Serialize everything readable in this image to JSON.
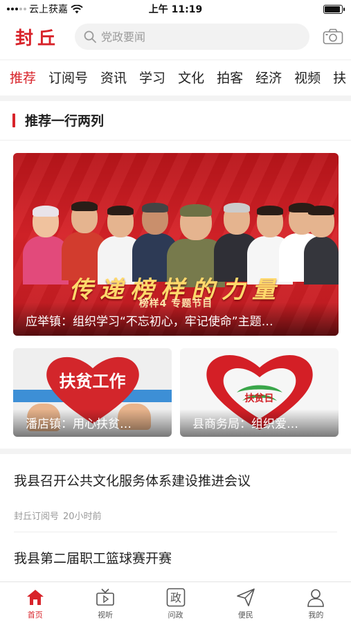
{
  "status_bar": {
    "carrier": "云上获嘉",
    "time": "上午 11:19"
  },
  "header": {
    "logo": "封丘",
    "search_placeholder": "党政要闻"
  },
  "tabs": [
    "推荐",
    "订阅号",
    "资讯",
    "学习",
    "文化",
    "拍客",
    "经济",
    "视频",
    "扶"
  ],
  "active_tab": "推荐",
  "section": {
    "title": "推荐一行两列"
  },
  "main_card": {
    "banner_title": "传递榜样的力量",
    "banner_subtitle": "榜样4 专题节目",
    "caption": "应举镇：组织学习“不忘初心，牢记使命”主题…"
  },
  "small_cards": [
    {
      "image_label": "扶贫工作",
      "caption": "潘店镇：用心扶贫…"
    },
    {
      "image_label": "扶贫日",
      "caption": "县商务局：组织爱…"
    }
  ],
  "news": [
    {
      "title": "我县召开公共文化服务体系建设推进会议",
      "source": "封丘订阅号",
      "time": "20小时前"
    },
    {
      "title": "我县第二届职工篮球赛开赛"
    }
  ],
  "bottom_nav": [
    {
      "label": "首页",
      "icon": "home-icon",
      "active": true
    },
    {
      "label": "视听",
      "icon": "tv-icon",
      "active": false
    },
    {
      "label": "问政",
      "icon": "politics-icon",
      "active": false
    },
    {
      "label": "便民",
      "icon": "send-icon",
      "active": false
    },
    {
      "label": "我的",
      "icon": "user-icon",
      "active": false
    }
  ],
  "colors": {
    "accent": "#d8232a",
    "divider": "#f3f3f3"
  }
}
